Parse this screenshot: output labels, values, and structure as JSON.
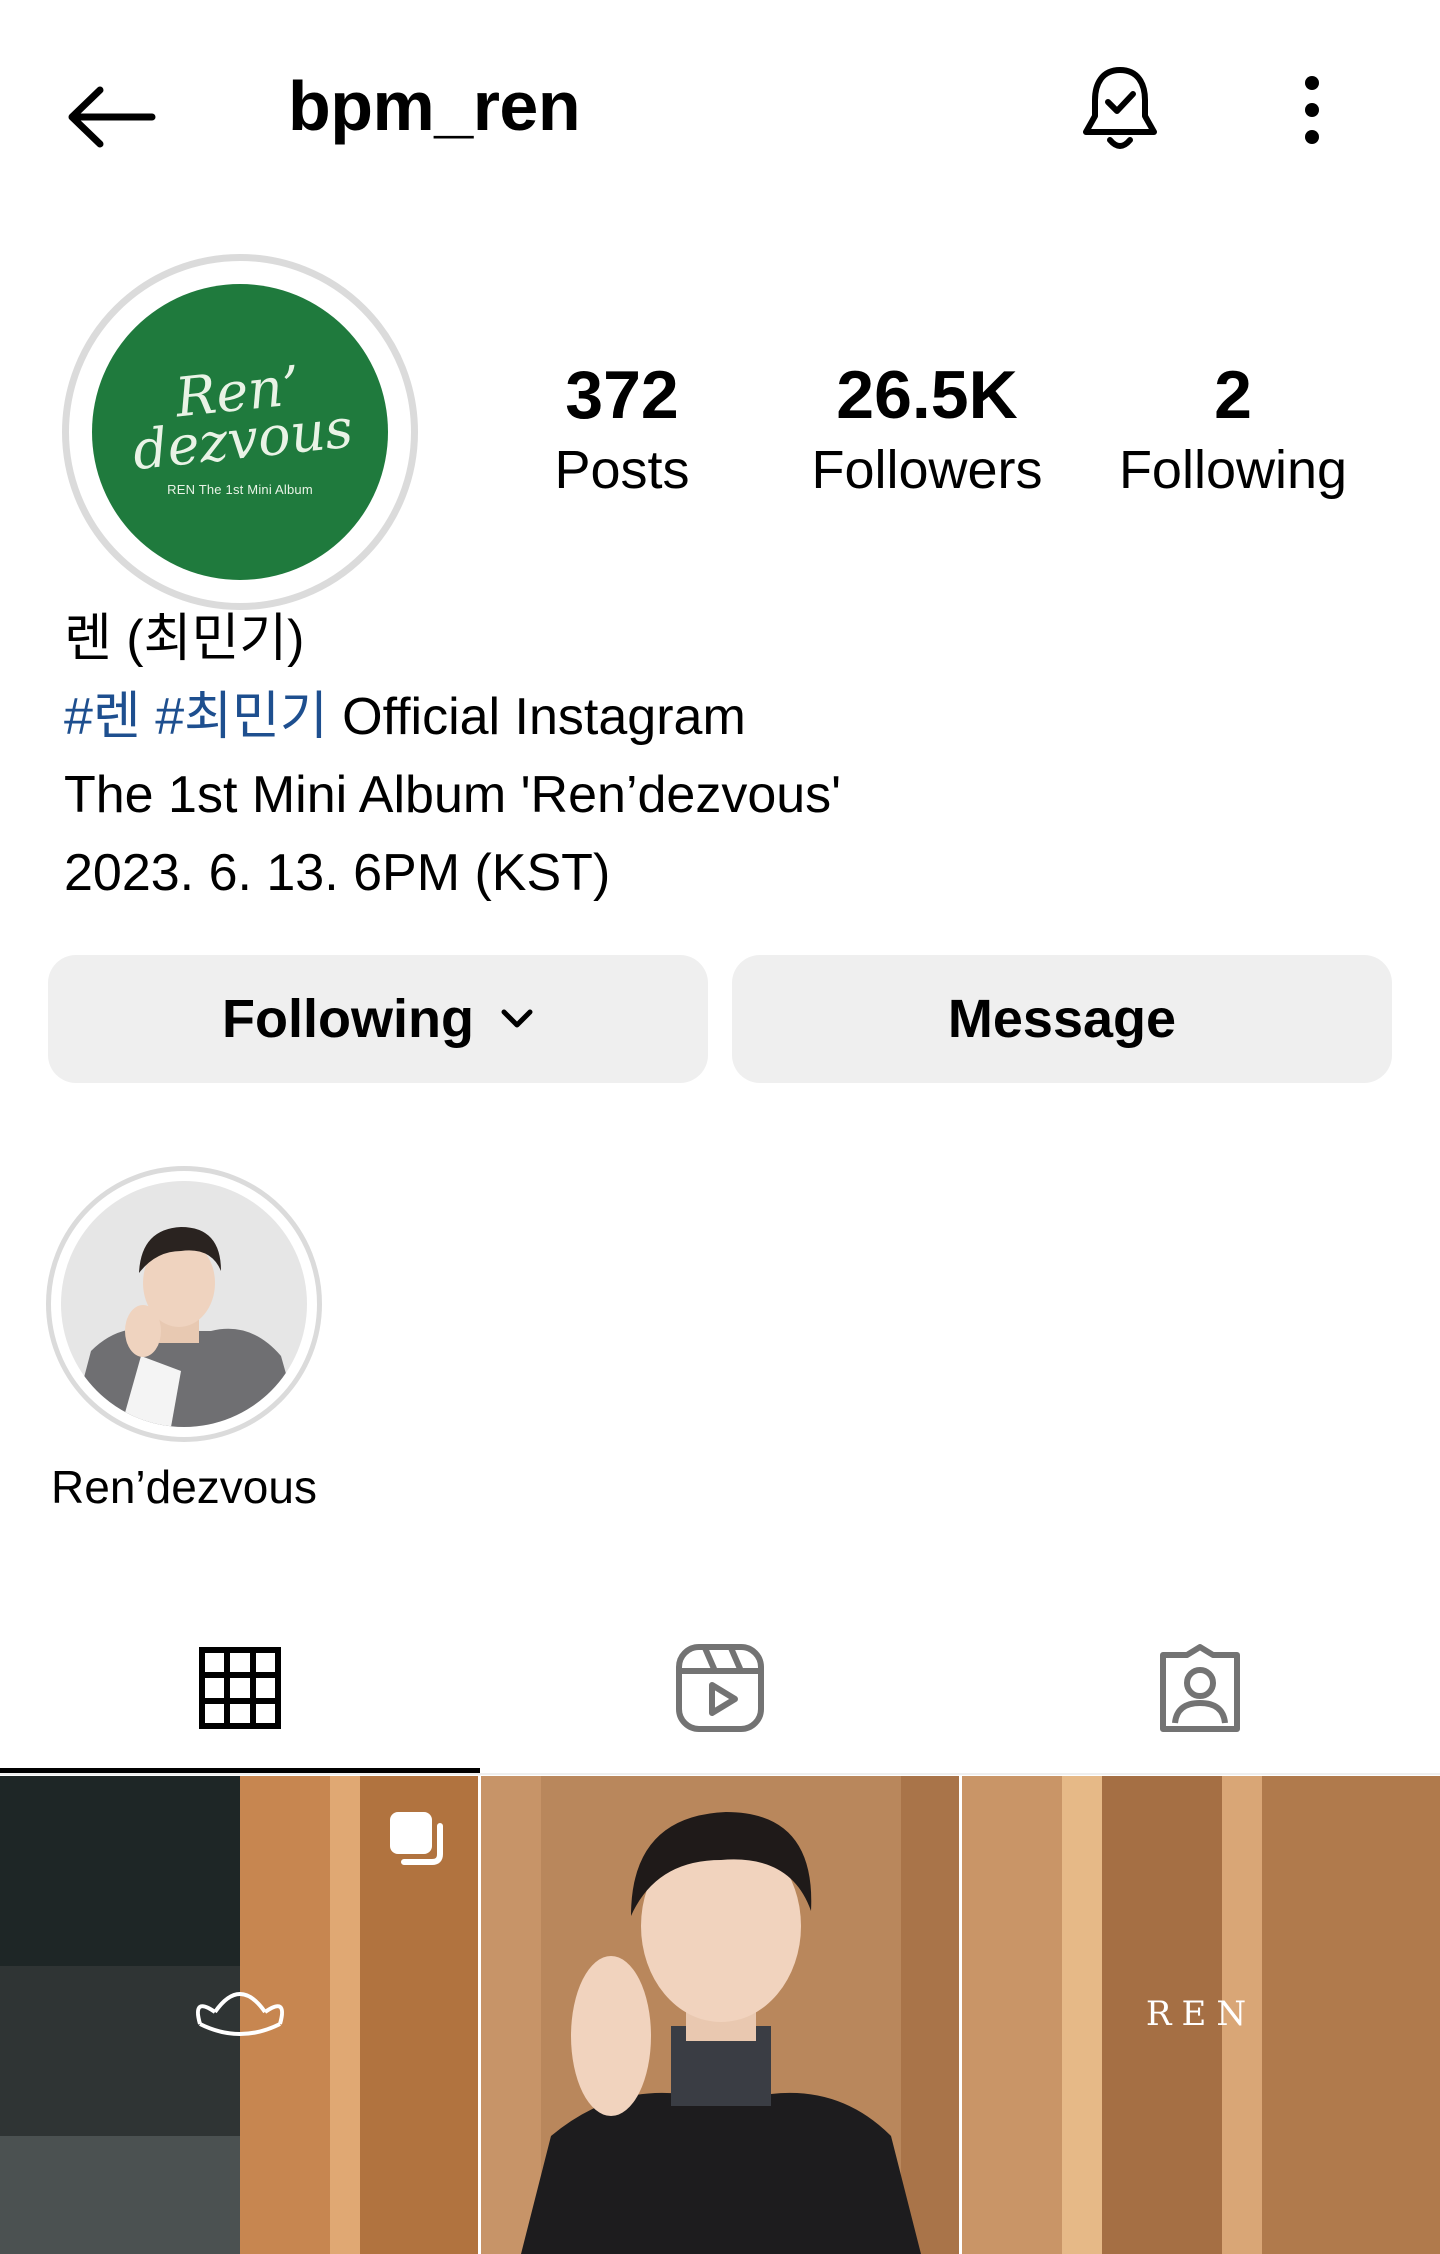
{
  "header": {
    "username": "bpm_ren",
    "back_icon": "arrow-left-icon",
    "notification_icon": "bell-check-icon",
    "more_icon": "more-vertical-icon"
  },
  "avatar": {
    "logo_line1": "Ren’",
    "logo_line2": "dezvous",
    "logo_subtitle": "REN The 1st Mini Album",
    "bg_color": "#1f7a3d"
  },
  "stats": [
    {
      "value": "372",
      "label": "Posts"
    },
    {
      "value": "26.5K",
      "label": "Followers"
    },
    {
      "value": "2",
      "label": "Following"
    }
  ],
  "bio": {
    "name": "렌 (최민기)",
    "hashtag1": "#렌",
    "hashtag2": "#최민기",
    "line2_rest": " Official Instagram",
    "line3": "The 1st Mini Album 'Ren’dezvous'",
    "line4": "2023. 6. 13. 6PM (KST)"
  },
  "actions": {
    "following_label": "Following",
    "message_label": "Message"
  },
  "highlights": [
    {
      "label": "Ren’dezvous"
    }
  ],
  "tabs": [
    {
      "name": "posts",
      "icon": "grid-icon",
      "active": true
    },
    {
      "name": "reels",
      "icon": "reels-icon",
      "active": false
    },
    {
      "name": "tagged",
      "icon": "tagged-user-icon",
      "active": false
    }
  ],
  "grid_posts": [
    {
      "type": "carousel",
      "icon": "multiple-posts-icon"
    },
    {
      "type": "photo"
    },
    {
      "type": "photo",
      "overlay_text": "REN"
    }
  ],
  "colors": {
    "hashtag": "#1e4f8f",
    "button_bg": "#efefef",
    "ring": "#dbdbdb"
  }
}
